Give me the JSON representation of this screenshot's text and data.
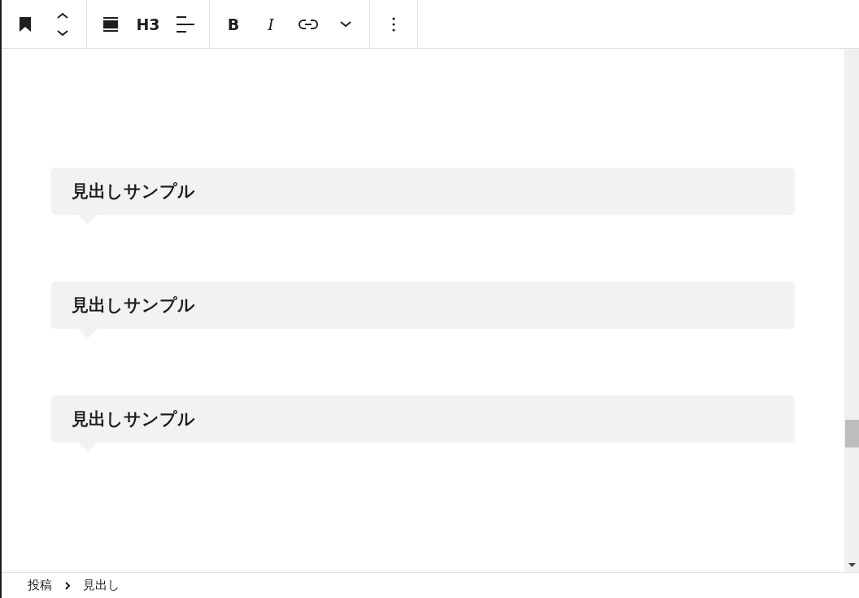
{
  "toolbar": {
    "heading_level": "H3",
    "bold": "B",
    "italic": "I"
  },
  "headings": [
    {
      "text": "見出しサンプル"
    },
    {
      "text": "見出しサンプル"
    },
    {
      "text": "見出しサンプル"
    }
  ],
  "breadcrumb": [
    {
      "label": "投稿"
    },
    {
      "label": "見出し"
    }
  ]
}
